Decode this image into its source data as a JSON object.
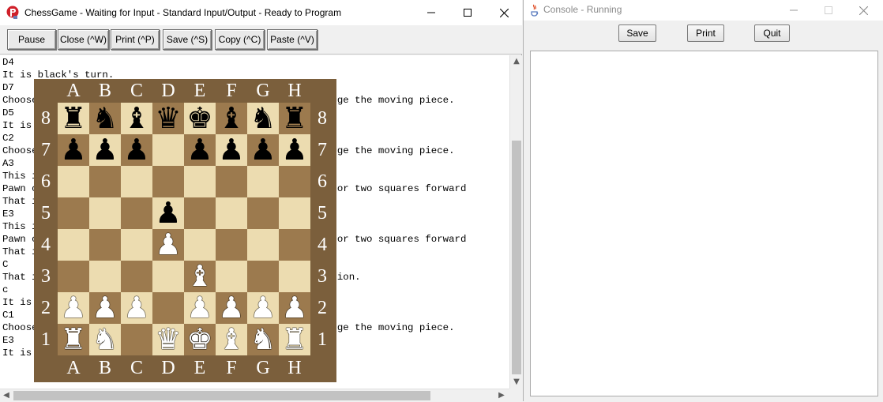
{
  "left_window": {
    "title": "ChessGame - Waiting for Input  - Standard Input/Output - Ready to Program",
    "toolbar": [
      {
        "name": "pause-button",
        "label": "Pause"
      },
      {
        "name": "close-button",
        "label": "Close (^W)"
      },
      {
        "name": "print-button",
        "label": "Print (^P)"
      },
      {
        "name": "save-button",
        "label": "Save (^S)"
      },
      {
        "name": "copy-button",
        "label": "Copy (^C)"
      },
      {
        "name": "paste-button",
        "label": "Paste (^V)"
      }
    ],
    "console_lines": [
      "D4",
      "It is black's turn.",
      "D7",
      "Choose where you want to move this piece. Press c to change the moving piece.",
      "D5",
      "It is white's turn.",
      "C2",
      "Choose where you want to move this piece. Press c to change the moving piece.",
      "A3",
      "This is an invalid move.",
      "Pawn can only move one square forward, forward diagonal, or two squares forward",
      "That is an invalid move. Type c or a new destination.",
      "E3",
      "This is an invalid move.",
      "Pawn can only move one square forward, forward diagonal, or two squares forward",
      "That is an invalid move. Type c or a new destination.",
      "C",
      "That is not a valid destination. Type c or a new destination.",
      "c",
      "It is white's turn.",
      "C1",
      "Choose where you want to move this piece. Press c to change the moving piece.",
      "E3",
      "It is black's turn."
    ]
  },
  "right_window": {
    "title": "Console - Running",
    "buttons": {
      "save": "Save",
      "print": "Print",
      "quit": "Quit"
    }
  },
  "board": {
    "files": [
      "A",
      "B",
      "C",
      "D",
      "E",
      "F",
      "G",
      "H"
    ],
    "ranks": [
      "8",
      "7",
      "6",
      "5",
      "4",
      "3",
      "2",
      "1"
    ],
    "colors": {
      "light": "#ecdcb0",
      "dark": "#9c7a4e",
      "frame": "#7b5f3c"
    },
    "rows": [
      [
        "bR",
        "bN",
        "bB",
        "bQ",
        "bK",
        "bB",
        "bN",
        "bR"
      ],
      [
        "bP",
        "bP",
        "bP",
        "",
        "bP",
        "bP",
        "bP",
        "bP"
      ],
      [
        "",
        "",
        "",
        "",
        "",
        "",
        "",
        ""
      ],
      [
        "",
        "",
        "",
        "bP",
        "",
        "",
        "",
        ""
      ],
      [
        "",
        "",
        "",
        "wP",
        "",
        "",
        "",
        ""
      ],
      [
        "",
        "",
        "",
        "",
        "wB",
        "",
        "",
        ""
      ],
      [
        "wP",
        "wP",
        "wP",
        "",
        "wP",
        "wP",
        "wP",
        "wP"
      ],
      [
        "wR",
        "wN",
        "",
        "wQ",
        "wK",
        "wB",
        "wN",
        "wR"
      ]
    ]
  }
}
